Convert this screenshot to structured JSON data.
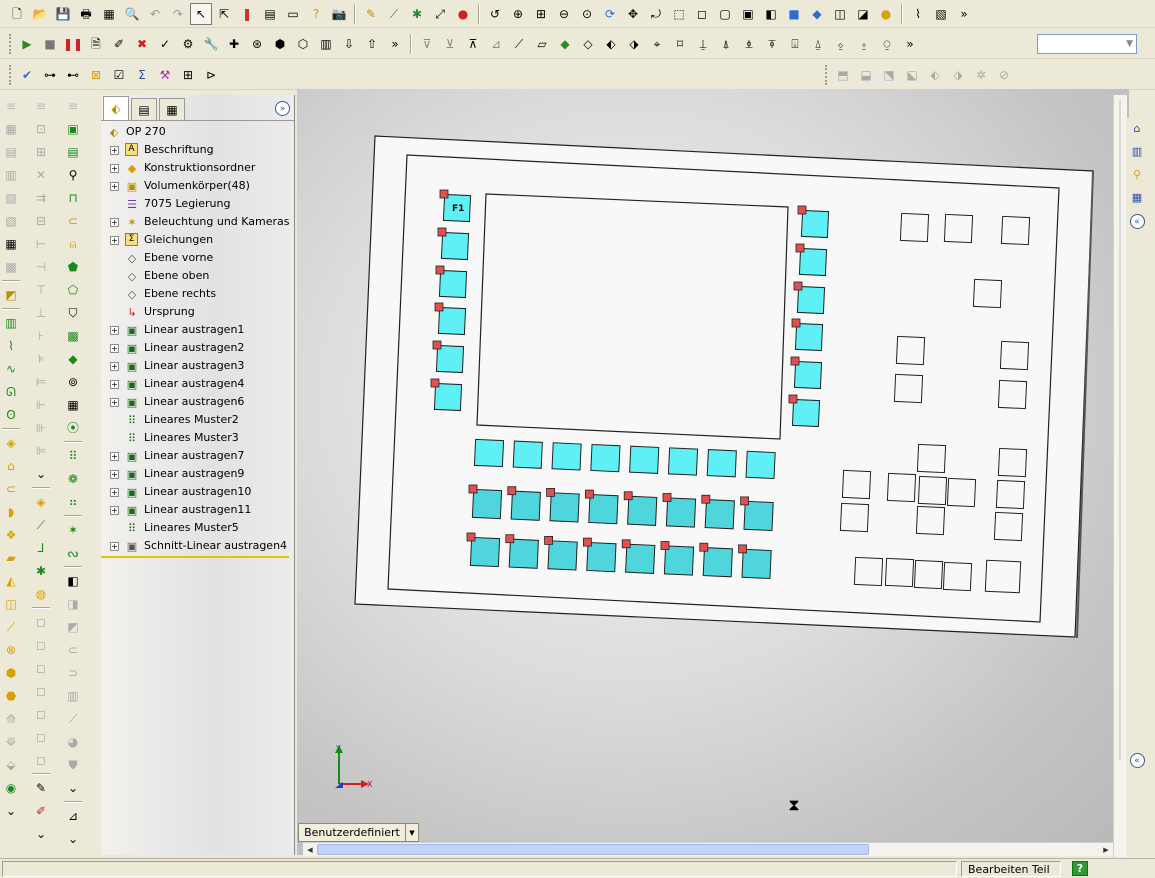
{
  "feature_manager": {
    "tabs": [
      "feature-tree-icon",
      "property-manager-icon",
      "configuration-manager-icon"
    ],
    "root": {
      "label": "OP 270",
      "icon": "part-icon"
    },
    "items": [
      {
        "label": "Beschriftung",
        "icon": "annotations-icon",
        "expand": true
      },
      {
        "label": "Konstruktionsordner",
        "icon": "design-binder-icon",
        "expand": true
      },
      {
        "label": "Volumenkörper(48)",
        "icon": "solid-bodies-icon",
        "expand": true
      },
      {
        "label": "7075 Legierung",
        "icon": "material-icon",
        "expand": false
      },
      {
        "label": "Beleuchtung und Kameras",
        "icon": "lights-cameras-icon",
        "expand": true
      },
      {
        "label": "Gleichungen",
        "icon": "equations-icon",
        "expand": true
      },
      {
        "label": "Ebene vorne",
        "icon": "plane-icon",
        "expand": false
      },
      {
        "label": "Ebene oben",
        "icon": "plane-icon",
        "expand": false
      },
      {
        "label": "Ebene rechts",
        "icon": "plane-icon",
        "expand": false
      },
      {
        "label": "Ursprung",
        "icon": "origin-icon",
        "expand": false
      },
      {
        "label": "Linear austragen1",
        "icon": "extrude-icon",
        "expand": true
      },
      {
        "label": "Linear austragen2",
        "icon": "extrude-icon",
        "expand": true
      },
      {
        "label": "Linear austragen3",
        "icon": "extrude-icon",
        "expand": true
      },
      {
        "label": "Linear austragen4",
        "icon": "extrude-icon",
        "expand": true
      },
      {
        "label": "Linear austragen6",
        "icon": "extrude-icon",
        "expand": true
      },
      {
        "label": "Lineares Muster2",
        "icon": "linear-pattern-icon",
        "expand": false
      },
      {
        "label": "Lineares Muster3",
        "icon": "linear-pattern-icon",
        "expand": false
      },
      {
        "label": "Linear austragen7",
        "icon": "extrude-icon",
        "expand": true
      },
      {
        "label": "Linear austragen9",
        "icon": "extrude-icon",
        "expand": true
      },
      {
        "label": "Linear austragen10",
        "icon": "extrude-icon",
        "expand": true
      },
      {
        "label": "Linear austragen11",
        "icon": "extrude-icon",
        "expand": true
      },
      {
        "label": "Lineares Muster5",
        "icon": "linear-pattern-icon",
        "expand": false
      },
      {
        "label": "Schnitt-Linear austragen4",
        "icon": "cut-extrude-icon",
        "expand": true
      }
    ]
  },
  "viewport": {
    "key_label": "F1",
    "triad": {
      "x": "X",
      "y": "Y"
    },
    "view_selector": "Benutzerdefiniert",
    "colors": {
      "key_fill": "#5ff0f6",
      "key_fill_dark": "#4fd6dc",
      "marker": "#e05050",
      "panel": "#f8f8f8"
    }
  },
  "status_bar": {
    "mode": "Bearbeiten Teil",
    "help": "?"
  }
}
